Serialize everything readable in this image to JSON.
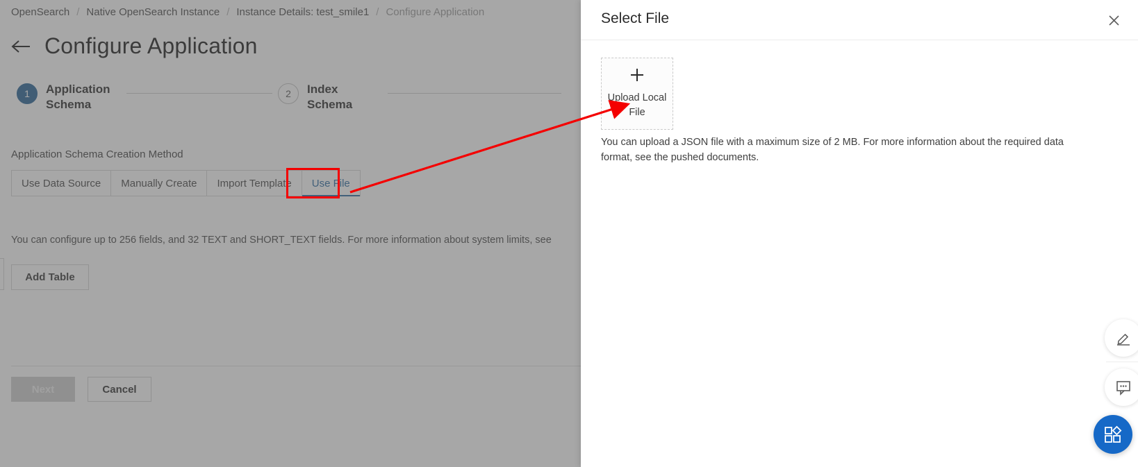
{
  "breadcrumb": {
    "separator": "/",
    "items": [
      {
        "label": "OpenSearch",
        "current": false
      },
      {
        "label": "Native OpenSearch Instance",
        "current": false
      },
      {
        "label": "Instance Details: test_smile1",
        "current": false
      },
      {
        "label": "Configure Application",
        "current": true
      }
    ]
  },
  "header": {
    "back_icon": "arrow-left-icon",
    "title": "Configure Application"
  },
  "stepper": {
    "steps": [
      {
        "number": "1",
        "label": "Application Schema",
        "state": "active"
      },
      {
        "number": "2",
        "label": "Index Schema",
        "state": "inactive"
      }
    ]
  },
  "form": {
    "section_label": "Application Schema Creation Method",
    "tabs": [
      {
        "label": "Use Data Source",
        "selected": false
      },
      {
        "label": "Manually Create",
        "selected": false
      },
      {
        "label": "Import Template",
        "selected": false
      },
      {
        "label": "Use File",
        "selected": true
      }
    ],
    "hint": "You can configure up to 256 fields, and 32 TEXT and SHORT_TEXT fields. For more information about system limits, see",
    "add_table_label": "Add Table"
  },
  "footer": {
    "next_label": "Next",
    "cancel_label": "Cancel"
  },
  "drawer": {
    "title": "Select File",
    "close_icon": "close-icon",
    "upload": {
      "plus_icon": "plus-icon",
      "label": "Upload Local File"
    },
    "description": "You can upload a JSON file with a maximum size of 2 MB. For more information about the required data format, see the pushed documents."
  },
  "fabs": [
    {
      "name": "edit-icon"
    },
    {
      "name": "chat-icon"
    },
    {
      "name": "apps-grid-icon"
    }
  ],
  "annotation": {
    "highlight_color": "#f40000",
    "arrow_from": "use-file-tab",
    "arrow_to": "upload-local-file-box"
  },
  "colors": {
    "accent": "#2d6ca2",
    "step_active": "#2a6496",
    "fab_primary": "#1669c7",
    "annotation_red": "#f40000"
  }
}
